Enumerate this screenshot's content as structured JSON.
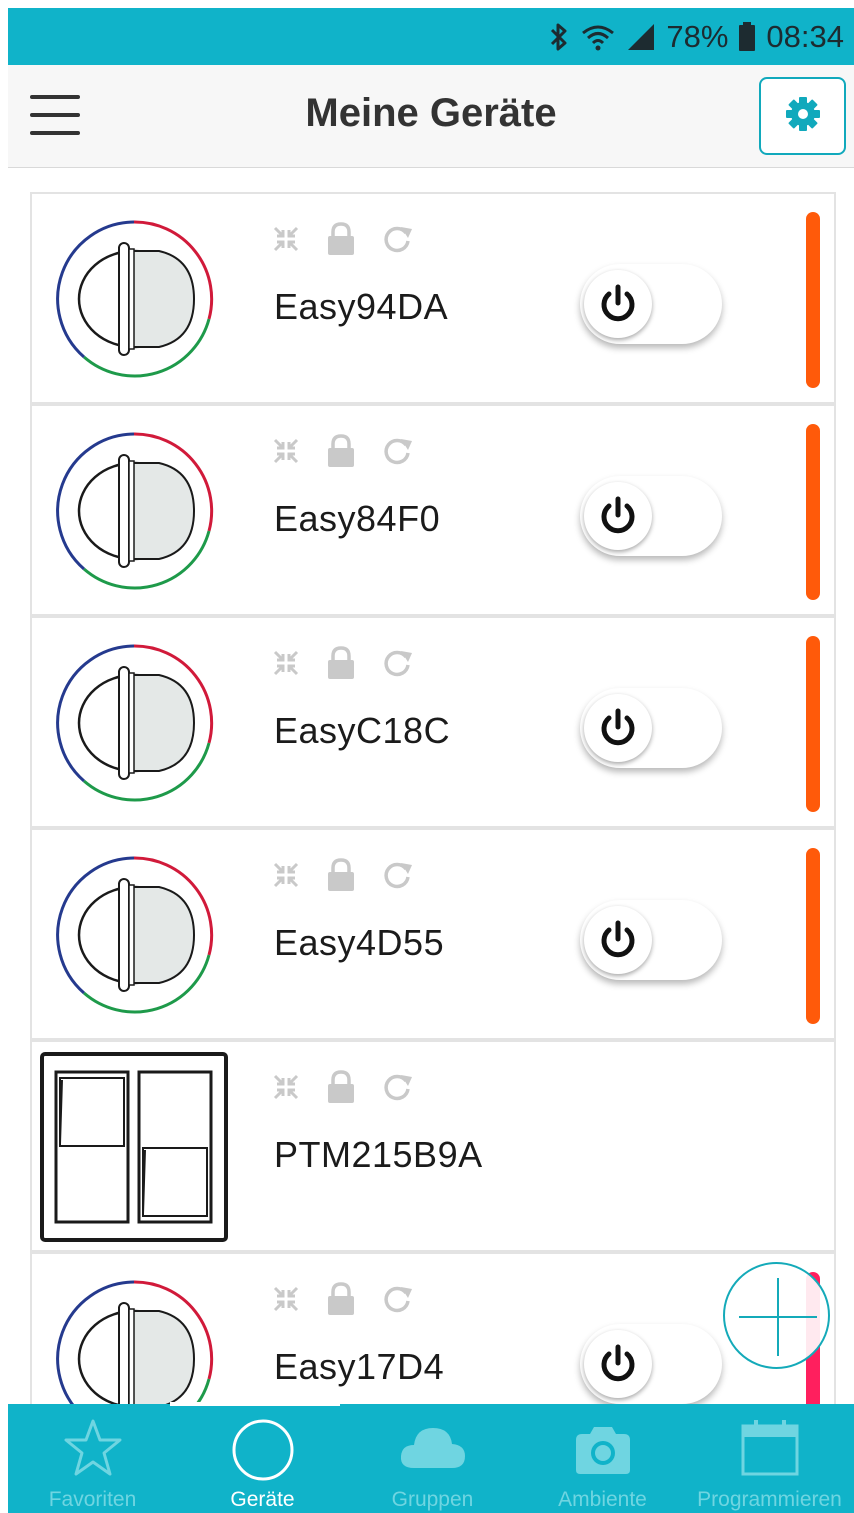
{
  "status_bar": {
    "battery": "78%",
    "time": "08:34"
  },
  "header": {
    "title": "Meine Geräte"
  },
  "devices": [
    {
      "name": "Easy94DA",
      "type": "round-switch",
      "has_toggle": true,
      "indicator_color": "#ff5a0a"
    },
    {
      "name": "Easy84F0",
      "type": "round-switch",
      "has_toggle": true,
      "indicator_color": "#ff5a0a"
    },
    {
      "name": "EasyC18C",
      "type": "round-switch",
      "has_toggle": true,
      "indicator_color": "#ff5a0a"
    },
    {
      "name": "Easy4D55",
      "type": "round-switch",
      "has_toggle": true,
      "indicator_color": "#ff5a0a"
    },
    {
      "name": "PTM215B9A",
      "type": "rocker-switch",
      "has_toggle": false,
      "indicator_color": ""
    },
    {
      "name": "Easy17D4",
      "type": "round-switch",
      "has_toggle": true,
      "indicator_color": "#ff1f5e"
    }
  ],
  "bottom_nav": {
    "items": [
      {
        "label": "Favoriten",
        "icon": "star-icon",
        "active": false
      },
      {
        "label": "Geräte",
        "icon": "circle-icon",
        "active": true
      },
      {
        "label": "Gruppen",
        "icon": "cloud-icon",
        "active": false
      },
      {
        "label": "Ambiente",
        "icon": "camera-icon",
        "active": false
      },
      {
        "label": "Programmieren",
        "icon": "calendar-icon",
        "active": false
      }
    ]
  },
  "colors": {
    "accent": "#10b3c9",
    "indicator": "#ff5a0a",
    "indicator_alt": "#ff1f5e"
  }
}
